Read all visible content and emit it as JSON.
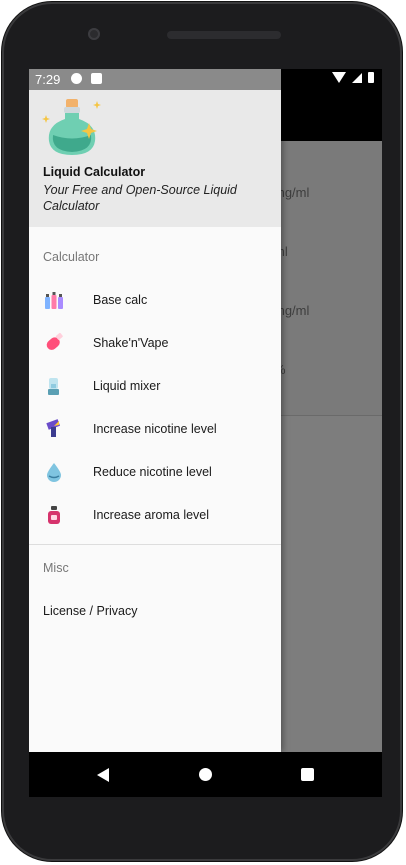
{
  "status": {
    "time": "7:29"
  },
  "drawer": {
    "title": "Liquid Calculator",
    "subtitle": "Your Free and Open-Source Liquid Calculator",
    "sections": {
      "calculator": "Calculator",
      "misc": "Misc"
    },
    "items": [
      {
        "label": "Base calc",
        "icon": "bottles-icon"
      },
      {
        "label": "Shake'n'Vape",
        "icon": "shaker-icon"
      },
      {
        "label": "Liquid mixer",
        "icon": "mixer-icon"
      },
      {
        "label": "Increase nicotine level",
        "icon": "increase-nicotine-icon"
      },
      {
        "label": "Reduce nicotine level",
        "icon": "drop-icon"
      },
      {
        "label": "Increase aroma level",
        "icon": "perfume-icon"
      }
    ],
    "misc_items": [
      {
        "label": "License / Privacy"
      }
    ]
  },
  "background_units": [
    "mg/ml",
    "ml",
    "mg/ml",
    "%"
  ],
  "colors": {
    "drawer_header_bg": "#e9e9e9",
    "drawer_bg": "#fafafa",
    "scrim": "#7d7d7d"
  }
}
